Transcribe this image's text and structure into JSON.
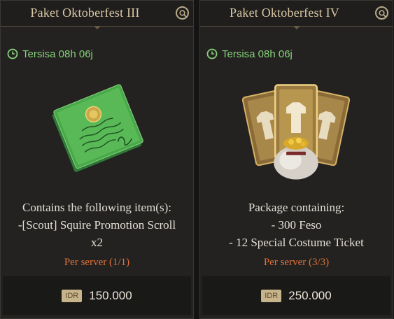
{
  "cards": [
    {
      "title": "Paket Oktoberfest III",
      "timer": "Tersisa 08h 06j",
      "description": [
        "Contains the following item(s):",
        "-[Scout] Squire Promotion Scroll",
        "x2"
      ],
      "limit": "Per server (1/1)",
      "currency": "IDR",
      "price": "150.000",
      "image_icon": "promotion-scroll-icon"
    },
    {
      "title": "Paket Oktoberfest IV",
      "timer": "Tersisa 08h 06j",
      "description": [
        "Package containing:",
        "- 300 Feso",
        "- 12 Special Costume Ticket"
      ],
      "limit": "Per server (3/3)",
      "currency": "IDR",
      "price": "250.000",
      "image_icon": "feso-costume-bundle-icon"
    }
  ],
  "colors": {
    "title": "#d8c8a6",
    "timer": "#86d07a",
    "limit": "#e0723a",
    "card_bg": "#232220"
  }
}
